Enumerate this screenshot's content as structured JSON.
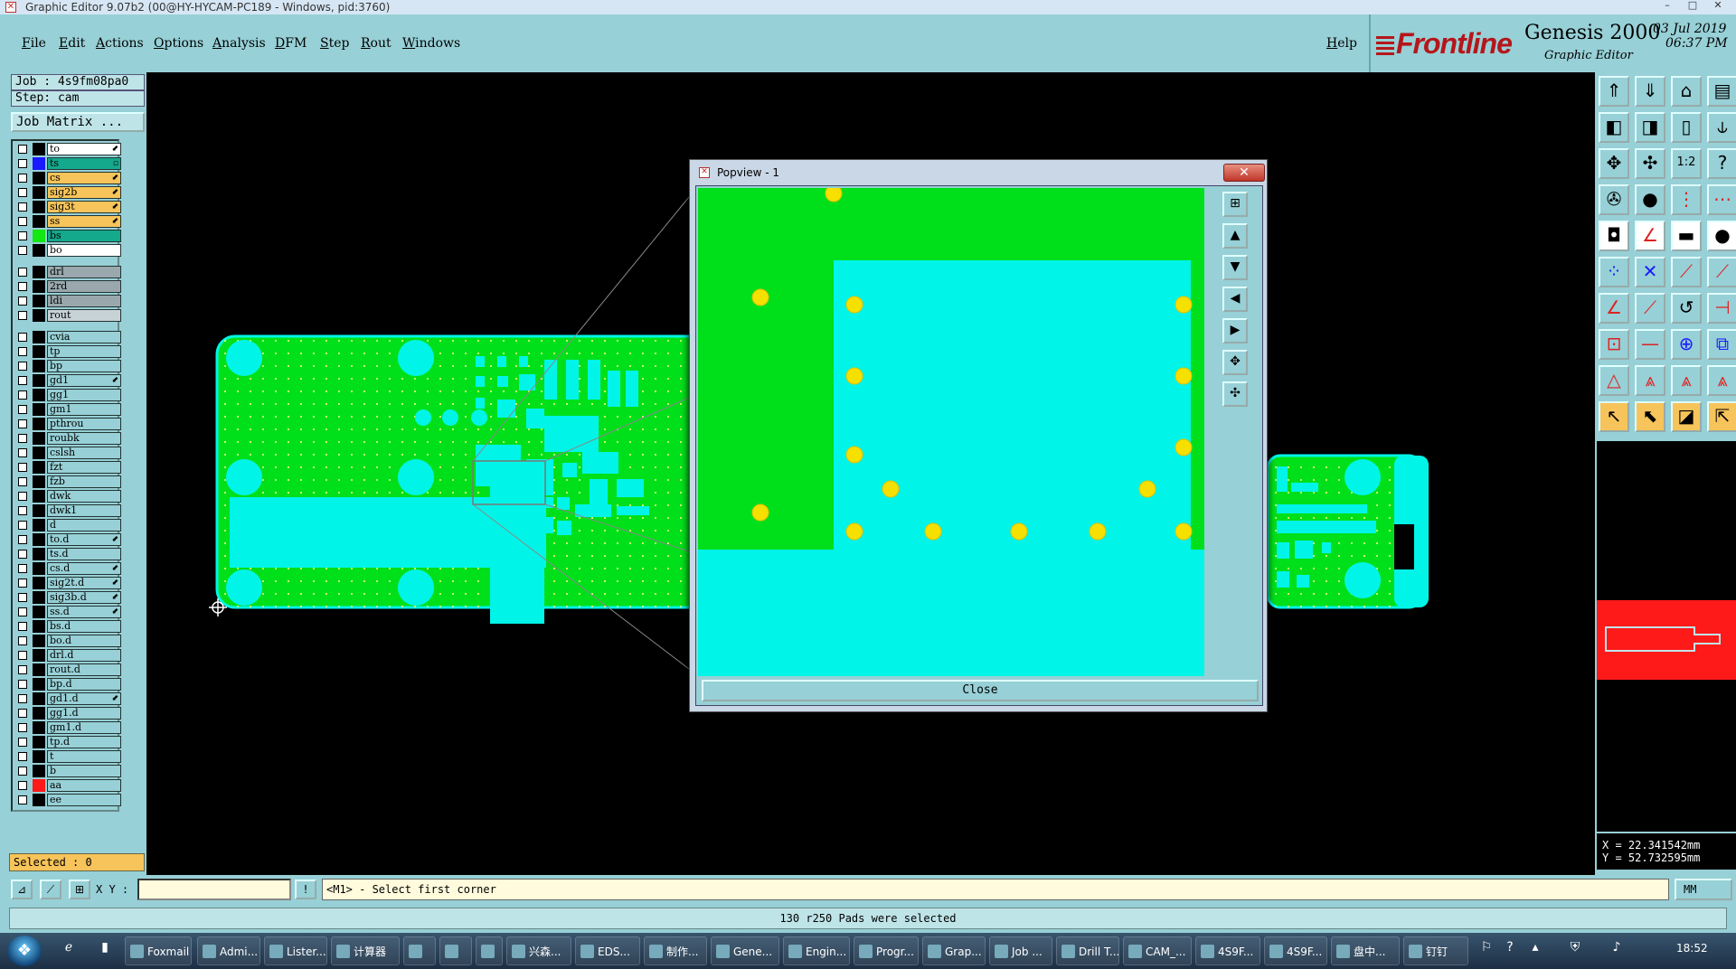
{
  "window": {
    "title": "Graphic Editor 9.07b2 (00@HY-HYCAM-PC189 - Windows, pid:3760)",
    "controls": [
      "–",
      "□",
      "✕"
    ]
  },
  "menu": {
    "items": [
      "File",
      "Edit",
      "Actions",
      "Options",
      "Analysis",
      "DFM",
      "Step",
      "Rout",
      "Windows"
    ],
    "help": "Help"
  },
  "brand": {
    "logo": "Frontline",
    "product": "Genesis 2000",
    "subtitle": "Graphic Editor",
    "date": "03 Jul 2019",
    "time": "06:37 PM"
  },
  "job": {
    "job_label": "Job : 4s9fm08pa0",
    "step_label": "Step: cam",
    "matrix_button": "Job Matrix ..."
  },
  "layers": [
    {
      "name": "to",
      "color": "#ffffff",
      "swatch": "#000000",
      "mark": "⬋"
    },
    {
      "name": "ts",
      "color": "#14a88c",
      "swatch": "#1a1aff",
      "mark": "▫"
    },
    {
      "name": "cs",
      "color": "#f6c45a",
      "swatch": "#000000",
      "mark": "⬋"
    },
    {
      "name": "sig2b",
      "color": "#f6c45a",
      "swatch": "#000000",
      "mark": "⬋"
    },
    {
      "name": "sig3t",
      "color": "#f6c45a",
      "swatch": "#000000",
      "mark": "⬋"
    },
    {
      "name": "ss",
      "color": "#f6c45a",
      "swatch": "#000000",
      "mark": "⬋"
    },
    {
      "name": "bs",
      "color": "#14a88c",
      "swatch": "#13e813",
      "mark": ""
    },
    {
      "name": "bo",
      "color": "#ffffff",
      "swatch": "#000000",
      "mark": ""
    },
    {
      "name": "drl",
      "color": "#9aa8ae",
      "swatch": "#000000",
      "mark": ""
    },
    {
      "name": "2rd",
      "color": "#9aa8ae",
      "swatch": "#000000",
      "mark": ""
    },
    {
      "name": "ldi",
      "color": "#9aa8ae",
      "swatch": "#000000",
      "mark": ""
    },
    {
      "name": "rout",
      "color": "#c7d2d6",
      "swatch": "#000000",
      "mark": ""
    },
    {
      "name": "cvia",
      "color": "#97d0d6",
      "swatch": "#000000",
      "mark": ""
    },
    {
      "name": "tp",
      "color": "#97d0d6",
      "swatch": "#000000",
      "mark": ""
    },
    {
      "name": "bp",
      "color": "#97d0d6",
      "swatch": "#000000",
      "mark": ""
    },
    {
      "name": "gd1",
      "color": "#97d0d6",
      "swatch": "#000000",
      "mark": "⬋"
    },
    {
      "name": "gg1",
      "color": "#97d0d6",
      "swatch": "#000000",
      "mark": ""
    },
    {
      "name": "gm1",
      "color": "#97d0d6",
      "swatch": "#000000",
      "mark": ""
    },
    {
      "name": "pthrou",
      "color": "#97d0d6",
      "swatch": "#000000",
      "mark": ""
    },
    {
      "name": "roubk",
      "color": "#97d0d6",
      "swatch": "#000000",
      "mark": ""
    },
    {
      "name": "cslsh",
      "color": "#97d0d6",
      "swatch": "#000000",
      "mark": ""
    },
    {
      "name": "fzt",
      "color": "#97d0d6",
      "swatch": "#000000",
      "mark": ""
    },
    {
      "name": "fzb",
      "color": "#97d0d6",
      "swatch": "#000000",
      "mark": ""
    },
    {
      "name": "dwk",
      "color": "#97d0d6",
      "swatch": "#000000",
      "mark": ""
    },
    {
      "name": "dwk1",
      "color": "#97d0d6",
      "swatch": "#000000",
      "mark": ""
    },
    {
      "name": "d",
      "color": "#97d0d6",
      "swatch": "#000000",
      "mark": ""
    },
    {
      "name": "to.d",
      "color": "#97d0d6",
      "swatch": "#000000",
      "mark": "⬋"
    },
    {
      "name": "ts.d",
      "color": "#97d0d6",
      "swatch": "#000000",
      "mark": ""
    },
    {
      "name": "cs.d",
      "color": "#97d0d6",
      "swatch": "#000000",
      "mark": "⬋"
    },
    {
      "name": "sig2t.d",
      "color": "#97d0d6",
      "swatch": "#000000",
      "mark": "⬋"
    },
    {
      "name": "sig3b.d",
      "color": "#97d0d6",
      "swatch": "#000000",
      "mark": "⬋"
    },
    {
      "name": "ss.d",
      "color": "#97d0d6",
      "swatch": "#000000",
      "mark": "⬋"
    },
    {
      "name": "bs.d",
      "color": "#97d0d6",
      "swatch": "#000000",
      "mark": ""
    },
    {
      "name": "bo.d",
      "color": "#97d0d6",
      "swatch": "#000000",
      "mark": ""
    },
    {
      "name": "drl.d",
      "color": "#97d0d6",
      "swatch": "#000000",
      "mark": ""
    },
    {
      "name": "rout.d",
      "color": "#97d0d6",
      "swatch": "#000000",
      "mark": ""
    },
    {
      "name": "bp.d",
      "color": "#97d0d6",
      "swatch": "#000000",
      "mark": ""
    },
    {
      "name": "gd1.d",
      "color": "#97d0d6",
      "swatch": "#000000",
      "mark": "⬋"
    },
    {
      "name": "gg1.d",
      "color": "#97d0d6",
      "swatch": "#000000",
      "mark": ""
    },
    {
      "name": "gm1.d",
      "color": "#97d0d6",
      "swatch": "#000000",
      "mark": ""
    },
    {
      "name": "tp.d",
      "color": "#97d0d6",
      "swatch": "#000000",
      "mark": ""
    },
    {
      "name": "t",
      "color": "#97d0d6",
      "swatch": "#000000",
      "mark": ""
    },
    {
      "name": "b",
      "color": "#97d0d6",
      "swatch": "#000000",
      "mark": ""
    },
    {
      "name": "aa",
      "color": "#97d0d6",
      "swatch": "#ff1a1a",
      "mark": ""
    },
    {
      "name": "ee",
      "color": "#97d0d6",
      "swatch": "#000000",
      "mark": ""
    }
  ],
  "selected": "Selected : 0",
  "popview": {
    "title": "Popview - 1",
    "close_x": "✕",
    "close_button": "Close"
  },
  "coords": {
    "x": "X = 22.341542mm",
    "y": "Y = 52.732595mm"
  },
  "command": {
    "xy_label": "X Y :",
    "xy_value": "",
    "prompt": "<M1> - Select first corner",
    "units": "MM"
  },
  "status": "130 r250 Pads were selected",
  "taskbar": {
    "items": [
      "Foxmail",
      "Admi...",
      "Lister...",
      "计算器",
      "",
      "",
      "",
      "兴森...",
      "EDS...",
      "制作...",
      "Gene...",
      "Engin...",
      "Progr...",
      "Grap...",
      "Job ...",
      "Drill T...",
      "CAM_...",
      "4S9F...",
      "4S9F...",
      "盘中...",
      "钉钉"
    ],
    "clock": "18:52"
  },
  "colors": {
    "board_green": "#00e01a",
    "copper_cyan": "#00f5e8",
    "pad_yellow": "#f5e000",
    "panel": "#97d0d6",
    "highlight": "#ff1a1a"
  }
}
